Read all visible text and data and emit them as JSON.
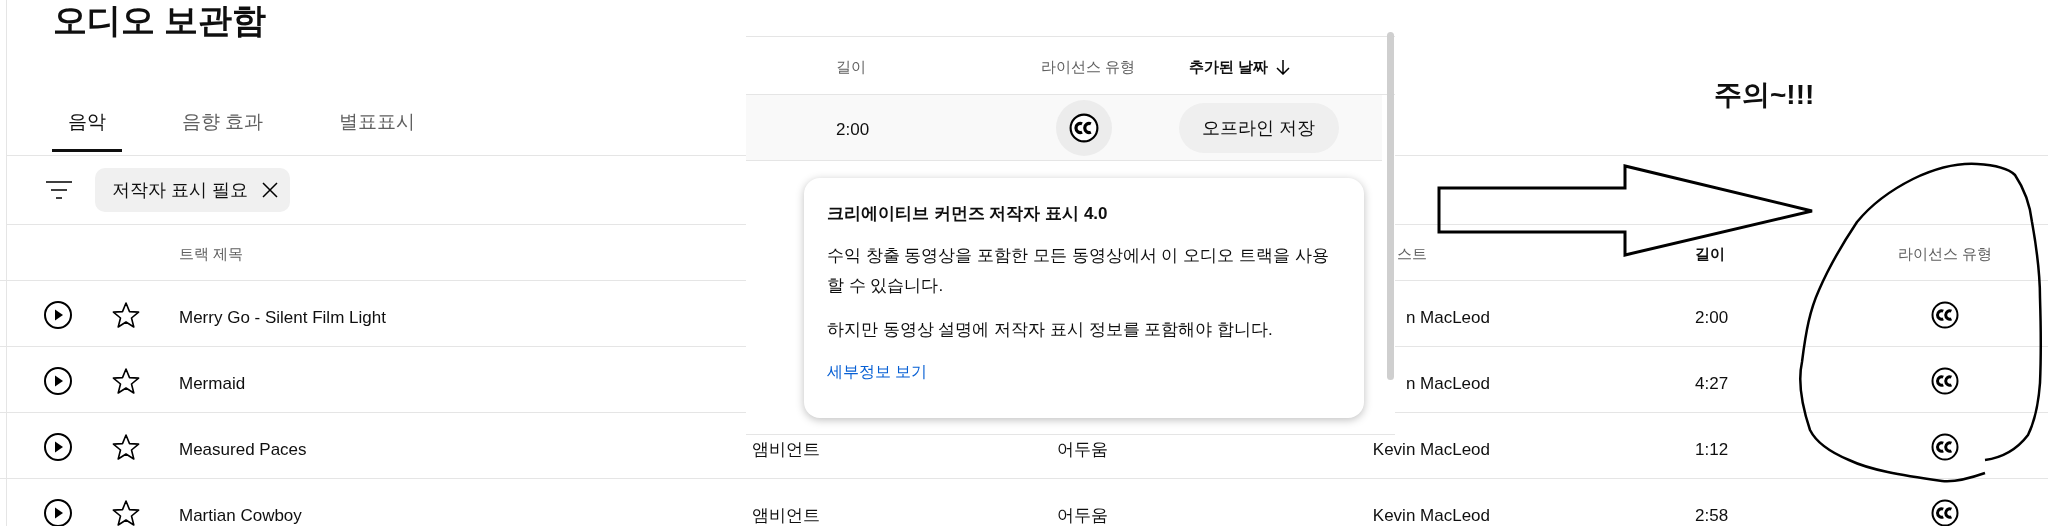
{
  "page": {
    "title": "오디오 보관함"
  },
  "tabs": [
    {
      "label": "음악",
      "selected": true
    },
    {
      "label": "음향 효과",
      "selected": false
    },
    {
      "label": "별표표시",
      "selected": false
    }
  ],
  "filter_chips": [
    {
      "label": "저작자 표시 필요"
    }
  ],
  "table": {
    "columns": [
      {
        "kind": "title",
        "label": "트랙 제목",
        "bold": false
      },
      {
        "kind": "artist",
        "label": "스트",
        "bold": false
      },
      {
        "kind": "length",
        "label": "길이",
        "bold": true
      },
      {
        "kind": "license",
        "label": "라이선스 유형",
        "bold": false
      }
    ],
    "rows": [
      {
        "title": "Merry Go - Silent Film Light",
        "artist": "n MacLeod",
        "length": "2:00"
      },
      {
        "title": "Mermaid",
        "artist": "n MacLeod",
        "length": "4:27"
      },
      {
        "title": "Measured Paces",
        "genre": "앰비언트",
        "mood": "어두움",
        "artist": "Kevin MacLeod",
        "length": "1:12"
      },
      {
        "title": "Martian Cowboy",
        "genre": "앰비언트",
        "mood": "어두움",
        "artist": "Kevin MacLeod",
        "length": "2:58"
      }
    ]
  },
  "inset": {
    "columns": [
      {
        "kind": "length",
        "label": "길이",
        "sorted": false
      },
      {
        "kind": "license",
        "label": "라이선스 유형",
        "sorted": false
      },
      {
        "kind": "date",
        "label": "추가된 날짜",
        "sorted": true
      }
    ],
    "row": {
      "length": "2:00",
      "button": "오프라인 저장"
    },
    "popover": {
      "title": "크리에이티브 커먼즈 저작자 표시 4.0",
      "paragraphs": [
        "수익 창출 동영상을 포함한 모든 동영상에서 이 오디오 트랙을 사용할 수 있습니다.",
        "하지만 동영상 설명에 저작자 표시 정보를 포함해야 합니다."
      ],
      "link": "세부정보 보기"
    }
  },
  "annotation": {
    "text": "주의~!!!"
  }
}
